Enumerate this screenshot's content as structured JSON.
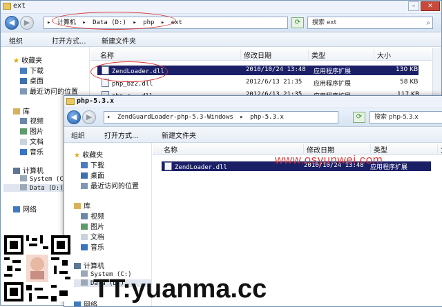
{
  "back_window": {
    "title": "ext",
    "address": [
      "计算机",
      "Data (D:)",
      "php",
      "ext"
    ],
    "search_placeholder": "搜索 ext",
    "toolbar": {
      "organize": "组织",
      "open_with": "打开方式...",
      "new_folder": "新建文件夹"
    },
    "nav": [
      {
        "label": "收藏夹",
        "icon": "star-icon"
      },
      {
        "label": "下载",
        "icon": "download-folder-icon"
      },
      {
        "label": "桌面",
        "icon": "desktop-icon"
      },
      {
        "label": "最近访问的位置",
        "icon": "recent-places-icon"
      },
      {
        "label": "库",
        "icon": "library-icon"
      },
      {
        "label": "视频",
        "icon": "video-icon"
      },
      {
        "label": "图片",
        "icon": "pictures-icon"
      },
      {
        "label": "文档",
        "icon": "documents-icon"
      },
      {
        "label": "音乐",
        "icon": "music-icon"
      },
      {
        "label": "计算机",
        "icon": "computer-icon"
      },
      {
        "label": "System (C",
        "icon": "drive-icon"
      },
      {
        "label": "Data (D:)",
        "icon": "drive-icon"
      },
      {
        "label": "网络",
        "icon": "network-icon"
      }
    ],
    "columns": {
      "name": "名称",
      "date": "修改日期",
      "type": "类型",
      "size": "大小"
    },
    "files": [
      {
        "name": "ZendLoader.dll",
        "date": "2010/10/24 13:48",
        "type": "应用程序扩展",
        "size": "130 KB"
      },
      {
        "name": "php_bz2.dll",
        "date": "2012/6/13 21:35",
        "type": "应用程序扩展",
        "size": "58 KB"
      },
      {
        "name": "php_c...dll",
        "date": "2012/6/13 21:35",
        "type": "应用程序扩展",
        "size": "117 KB"
      }
    ]
  },
  "front_window": {
    "title": "php-5.3.x",
    "address": [
      "ZendGuardLoader-php-5.3-Windows",
      "php-5.3.x"
    ],
    "search_placeholder": "搜索 php-5.3.x",
    "toolbar": {
      "organize": "组织",
      "open_with": "打开方式...",
      "new_folder": "新建文件夹"
    },
    "nav": [
      {
        "label": "收藏夹",
        "icon": "star-icon"
      },
      {
        "label": "下载",
        "icon": "download-folder-icon"
      },
      {
        "label": "桌面",
        "icon": "desktop-icon"
      },
      {
        "label": "最近访问的位置",
        "icon": "recent-places-icon"
      },
      {
        "label": "库",
        "icon": "library-icon"
      },
      {
        "label": "视频",
        "icon": "video-icon"
      },
      {
        "label": "图片",
        "icon": "pictures-icon"
      },
      {
        "label": "文档",
        "icon": "documents-icon"
      },
      {
        "label": "音乐",
        "icon": "music-icon"
      },
      {
        "label": "计算机",
        "icon": "computer-icon"
      },
      {
        "label": "System (C:)",
        "icon": "drive-icon"
      },
      {
        "label": "Data (D:)",
        "icon": "drive-icon"
      },
      {
        "label": "网络",
        "icon": "network-icon"
      }
    ],
    "columns": {
      "name": "名称",
      "date": "修改日期",
      "type": "类型",
      "extra": "大"
    },
    "files": [
      {
        "name": "ZendLoader.dll",
        "date": "2010/10/24 13:48",
        "type": "应用程序扩展"
      }
    ]
  },
  "watermark_text": "www.osyunwei.com",
  "brand_text": "TT:yuanma.cc",
  "colors": {
    "selection": "#1b1f66",
    "annotation": "#dd3333",
    "watermark": "#d93030"
  }
}
